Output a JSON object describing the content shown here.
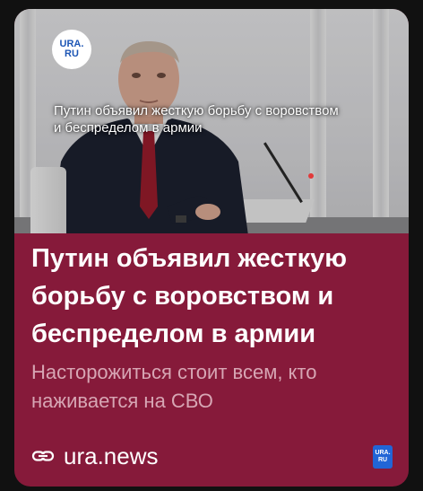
{
  "card": {
    "photo_logo_line1": "URA.",
    "photo_logo_line2": "RU",
    "photo_caption": "Путин объявил жесткую борьбу с воровством и беспределом в армии",
    "headline": "Путин объявил жесткую борьбу с воровством и беспределом в армии",
    "subtitle": "Насторожиться стоит всем, кто наживается на СВО",
    "domain": "ura.news",
    "badge_line1": "URA.",
    "badge_line2": "RU",
    "icons": {
      "link": "link-icon",
      "logo": "ura-logo-icon",
      "badge": "ura-badge-icon"
    },
    "colors": {
      "card_background": "#861a3a",
      "subtitle": "#d7a6b4",
      "logo_text": "#1d56b5",
      "badge_background": "#2165d6"
    }
  }
}
